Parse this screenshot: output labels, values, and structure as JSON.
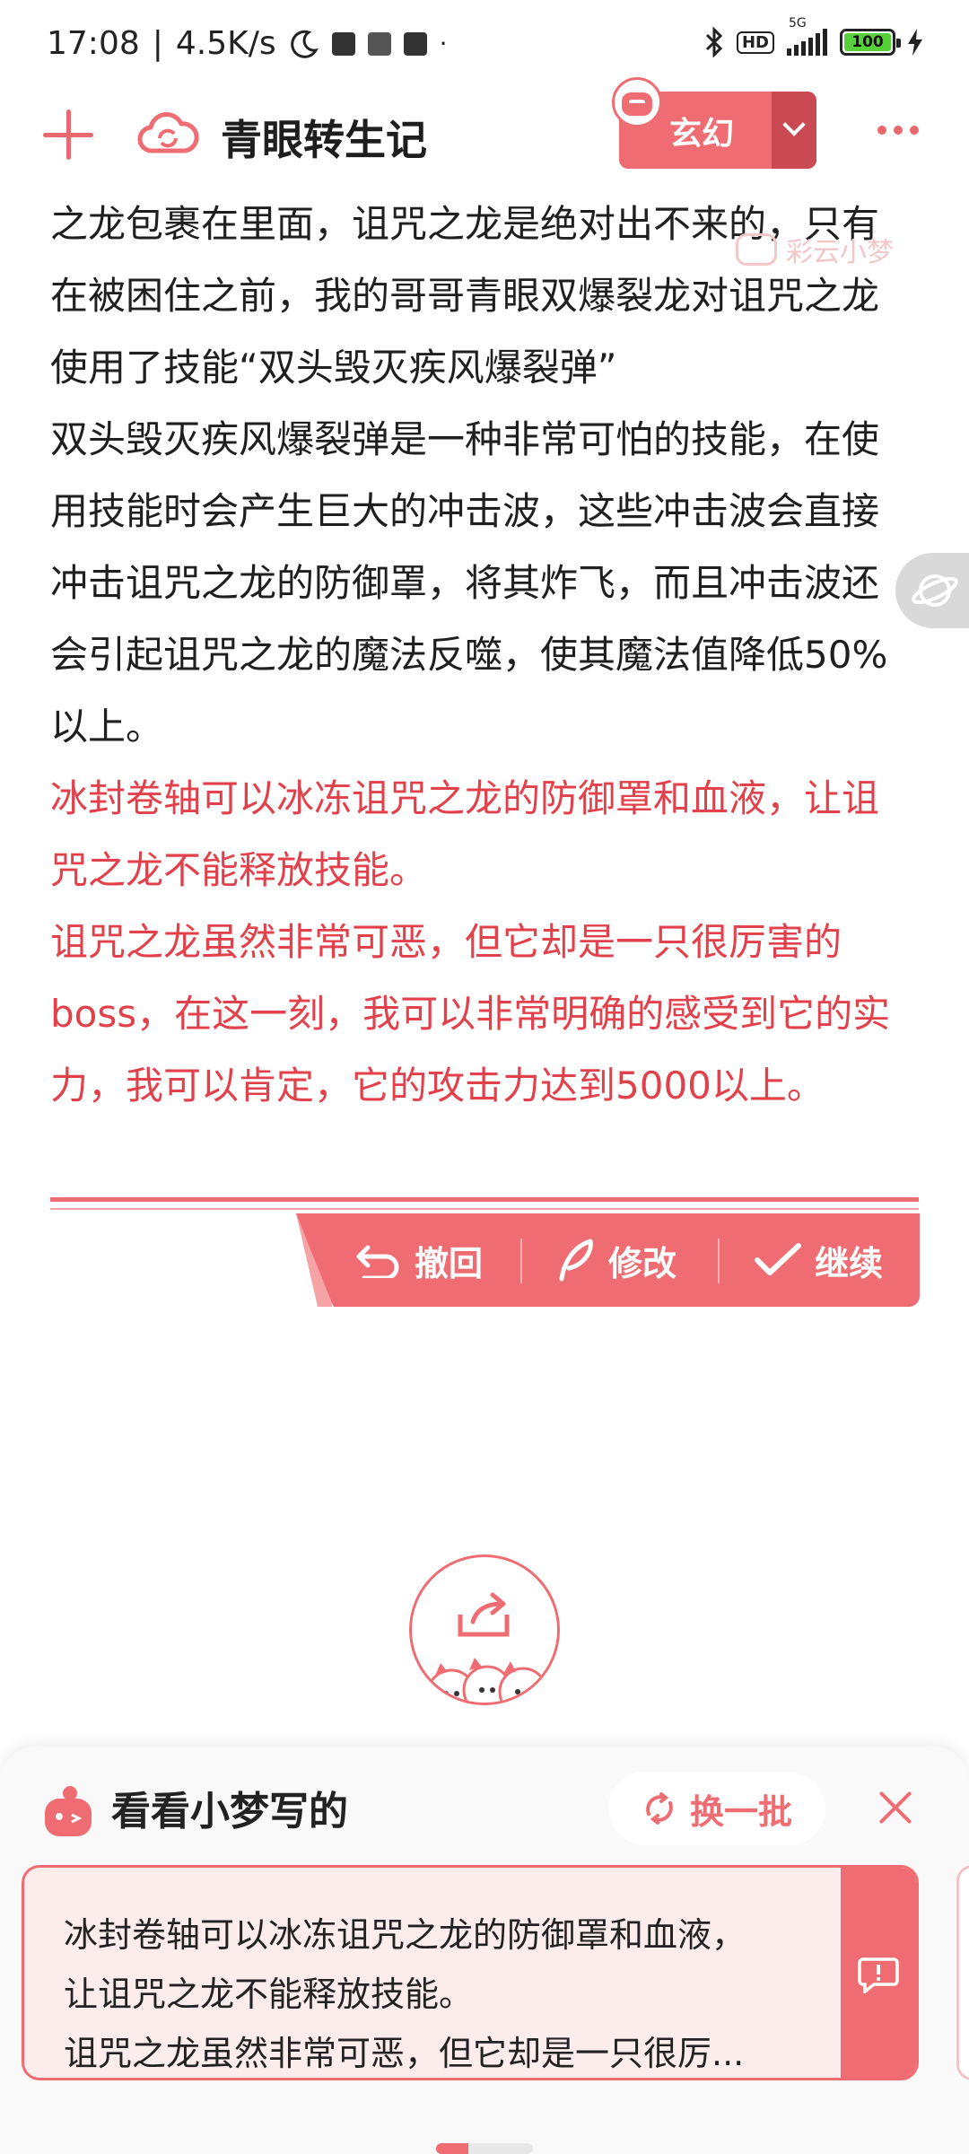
{
  "status_bar": {
    "time": "17:08",
    "net_speed": "4.5K/s",
    "hd_label": "HD",
    "network": "5G",
    "battery": "100"
  },
  "header": {
    "title": "青眼转生记",
    "genre": "玄幻"
  },
  "watermark": "彩云小梦",
  "story": {
    "paragraphs": [
      "之龙包裹在里面，诅咒之龙是绝对出不来的，只有在被困住之前，我的哥哥青眼双爆裂龙对诅咒之龙使用了技能“双头毁灭疾风爆裂弹”",
      "双头毁灭疾风爆裂弹是一种非常可怕的技能，在使用技能时会产生巨大的冲击波，这些冲击波会直接冲击诅咒之龙的防御罩，将其炸飞，而且冲击波还会引起诅咒之龙的魔法反噬，使其魔法值降低50%以上。"
    ],
    "generated": [
      "冰封卷轴可以冰冻诅咒之龙的防御罩和血液，让诅咒之龙不能释放技能。",
      "诅咒之龙虽然非常可恶，但它却是一只很厉害的boss，在这一刻，我可以非常明确的感受到它的实力，我可以肯定，它的攻击力达到5000以上。"
    ]
  },
  "actions": {
    "undo": "撤回",
    "edit": "修改",
    "continue": "继续"
  },
  "panel": {
    "title": "看看小梦写的",
    "refresh": "换一批",
    "card_lines": [
      "冰封卷轴可以冰冻诅咒之龙的防御罩和血液，",
      "让诅咒之龙不能释放技能。",
      "诅咒之龙虽然非常可恶，但它却是一只很厉..."
    ]
  },
  "colors": {
    "accent": "#ef6d72",
    "generated_text": "#e2414b",
    "card_bg": "#fdecec"
  },
  "icons": [
    "plus-icon",
    "cloud-sync-icon",
    "chevron-down-icon",
    "more-icon",
    "undo-icon",
    "pen-icon",
    "check-icon",
    "share-icon",
    "refresh-icon",
    "close-icon",
    "feedback-icon",
    "planet-icon"
  ]
}
